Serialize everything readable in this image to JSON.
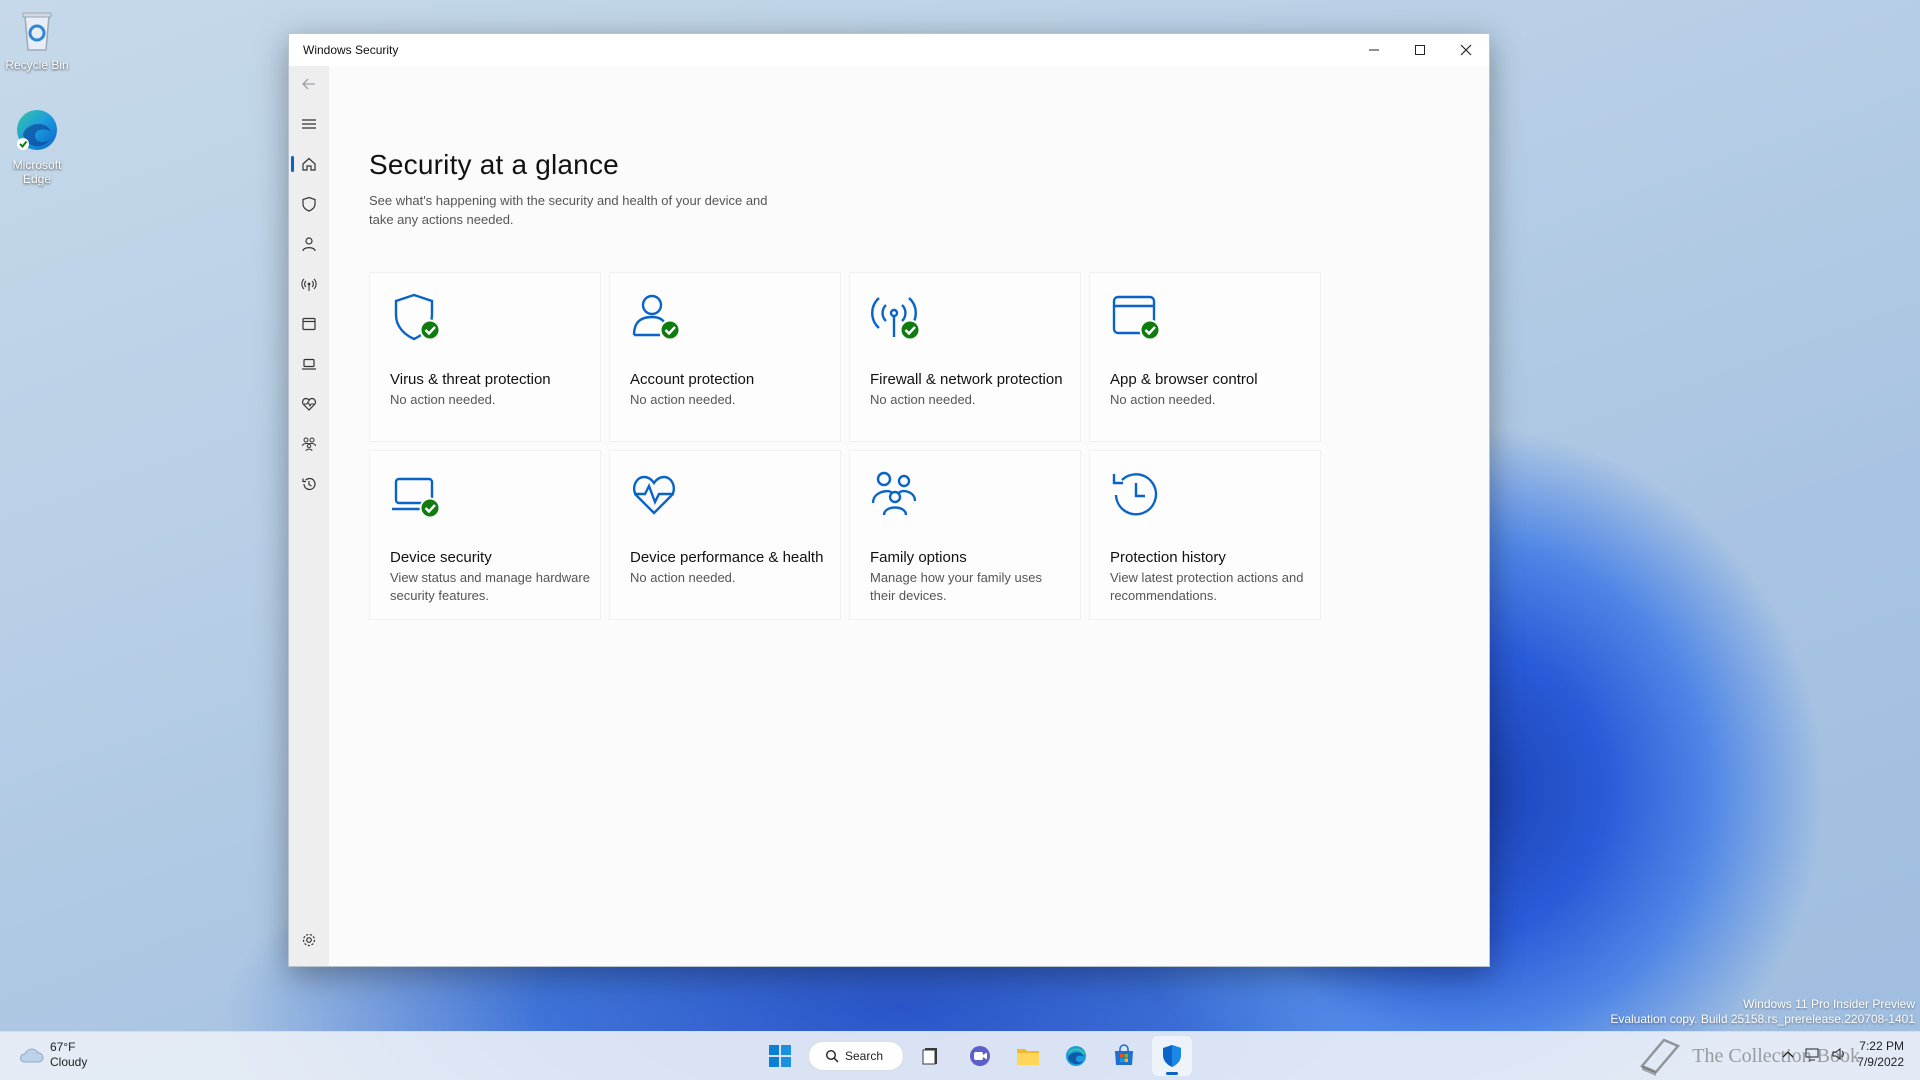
{
  "desktop": {
    "icons": [
      {
        "label": "Recycle Bin"
      },
      {
        "label": "Microsoft Edge"
      }
    ],
    "eval_line1": "Windows 11 Pro Insider Preview",
    "eval_line2": "Evaluation copy. Build 25158.rs_prerelease.220708-1401"
  },
  "window": {
    "title": "Windows Security",
    "controls": [
      "minimize-icon",
      "maximize-icon",
      "close-icon"
    ],
    "accent": "#0a64c8",
    "check_color": "#107c10"
  },
  "rail": {
    "items": [
      "back-arrow-icon",
      "hamburger-menu-icon",
      "home-icon",
      "shield-icon",
      "person-icon",
      "wireless-icon",
      "app-browser-icon",
      "laptop-icon",
      "heart-health-icon",
      "family-icon",
      "history-icon"
    ],
    "settings": "gear-icon"
  },
  "main": {
    "title": "Security at a glance",
    "subtitle": "See what's happening with the security and health of your device and take any actions needed.",
    "tiles": [
      {
        "icon": "shield-check-icon",
        "title": "Virus & threat protection",
        "desc": "No action needed."
      },
      {
        "icon": "account-check-icon",
        "title": "Account protection",
        "desc": "No action needed."
      },
      {
        "icon": "firewall-check-icon",
        "title": "Firewall & network protection",
        "desc": "No action needed."
      },
      {
        "icon": "app-browser-check-icon",
        "title": "App & browser control",
        "desc": "No action needed."
      },
      {
        "icon": "device-security-check-icon",
        "title": "Device security",
        "desc": "View status and manage hardware security features."
      },
      {
        "icon": "device-health-icon",
        "title": "Device performance & health",
        "desc": "No action needed."
      },
      {
        "icon": "family-options-icon",
        "title": "Family options",
        "desc": "Manage how your family uses their devices."
      },
      {
        "icon": "protection-history-icon",
        "title": "Protection history",
        "desc": "View latest protection actions and recommendations."
      }
    ]
  },
  "taskbar": {
    "weather_temp": "67°F",
    "weather_desc": "Cloudy",
    "search_label": "Search",
    "apps": [
      "windows-start-icon",
      "search",
      "task-view-icon",
      "chat-icon",
      "file-explorer-icon",
      "edge-icon",
      "store-icon",
      "windows-security-icon"
    ],
    "time": "7:22 PM",
    "date": "7/9/2022",
    "watermark": "The Collection Book"
  }
}
